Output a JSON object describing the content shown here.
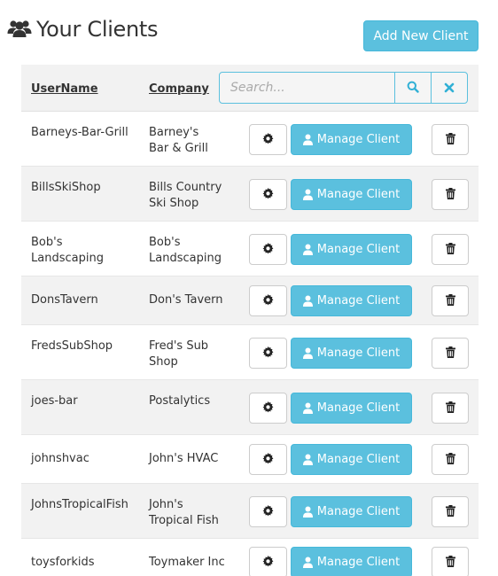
{
  "header": {
    "title": "Your Clients",
    "title_icon": "users-icon",
    "add_button_label": "Add New Client"
  },
  "table": {
    "columns": {
      "username": "UserName",
      "company": "Company"
    },
    "search": {
      "placeholder": "Search...",
      "value": "",
      "search_icon": "search-icon",
      "clear_icon": "close-icon"
    },
    "manage_label": "Manage Client",
    "rows": [
      {
        "username": "Barneys-Bar-Grill",
        "company": "Barney's Bar & Grill"
      },
      {
        "username": "BillsSkiShop",
        "company": "Bills Country Ski Shop"
      },
      {
        "username": "Bob's Landscaping",
        "company": "Bob's Landscaping"
      },
      {
        "username": "DonsTavern",
        "company": "Don's Tavern"
      },
      {
        "username": "FredsSubShop",
        "company": "Fred's Sub Shop"
      },
      {
        "username": "joes-bar",
        "company": "Postalytics"
      },
      {
        "username": "johnshvac",
        "company": "John's HVAC"
      },
      {
        "username": "JohnsTropicalFish",
        "company": "John's Tropical Fish"
      },
      {
        "username": "toysforkids",
        "company": "Toymaker Inc"
      }
    ]
  },
  "colors": {
    "accent": "#5bc0de",
    "accent_border": "#46b8da",
    "stripe": "#f2f2f2"
  }
}
